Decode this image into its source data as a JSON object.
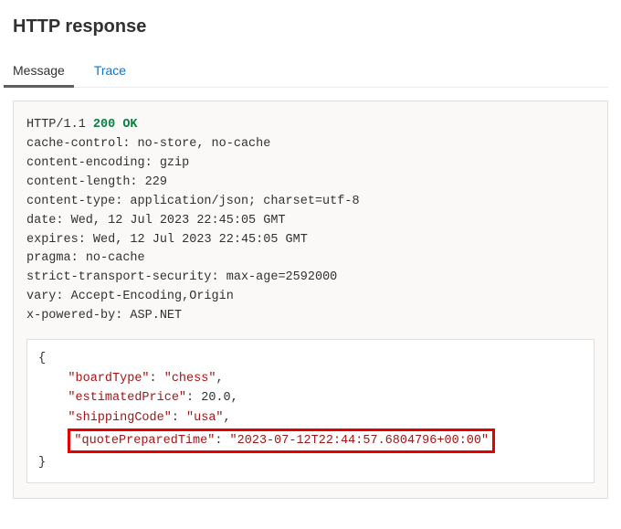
{
  "title": "HTTP response",
  "tabs": {
    "message": "Message",
    "trace": "Trace"
  },
  "http": {
    "protocol": "HTTP/1.1",
    "status": "200 OK",
    "headers": [
      {
        "name": "cache-control",
        "value": "no-store, no-cache"
      },
      {
        "name": "content-encoding",
        "value": "gzip"
      },
      {
        "name": "content-length",
        "value": "229"
      },
      {
        "name": "content-type",
        "value": "application/json; charset=utf-8"
      },
      {
        "name": "date",
        "value": "Wed, 12 Jul 2023 22:45:05 GMT"
      },
      {
        "name": "expires",
        "value": "Wed, 12 Jul 2023 22:45:05 GMT"
      },
      {
        "name": "pragma",
        "value": "no-cache"
      },
      {
        "name": "strict-transport-security",
        "value": "max-age=2592000"
      },
      {
        "name": "vary",
        "value": "Accept-Encoding,Origin"
      },
      {
        "name": "x-powered-by",
        "value": "ASP.NET"
      }
    ]
  },
  "body": {
    "boardType_key": "\"boardType\"",
    "boardType_val": "\"chess\"",
    "estimatedPrice_key": "\"estimatedPrice\"",
    "estimatedPrice_val": "20.0",
    "shippingCode_key": "\"shippingCode\"",
    "shippingCode_val": "\"usa\"",
    "quotePreparedTime_key": "\"quotePreparedTime\"",
    "quotePreparedTime_val": "\"2023-07-12T22:44:57.6804796+00:00\""
  }
}
